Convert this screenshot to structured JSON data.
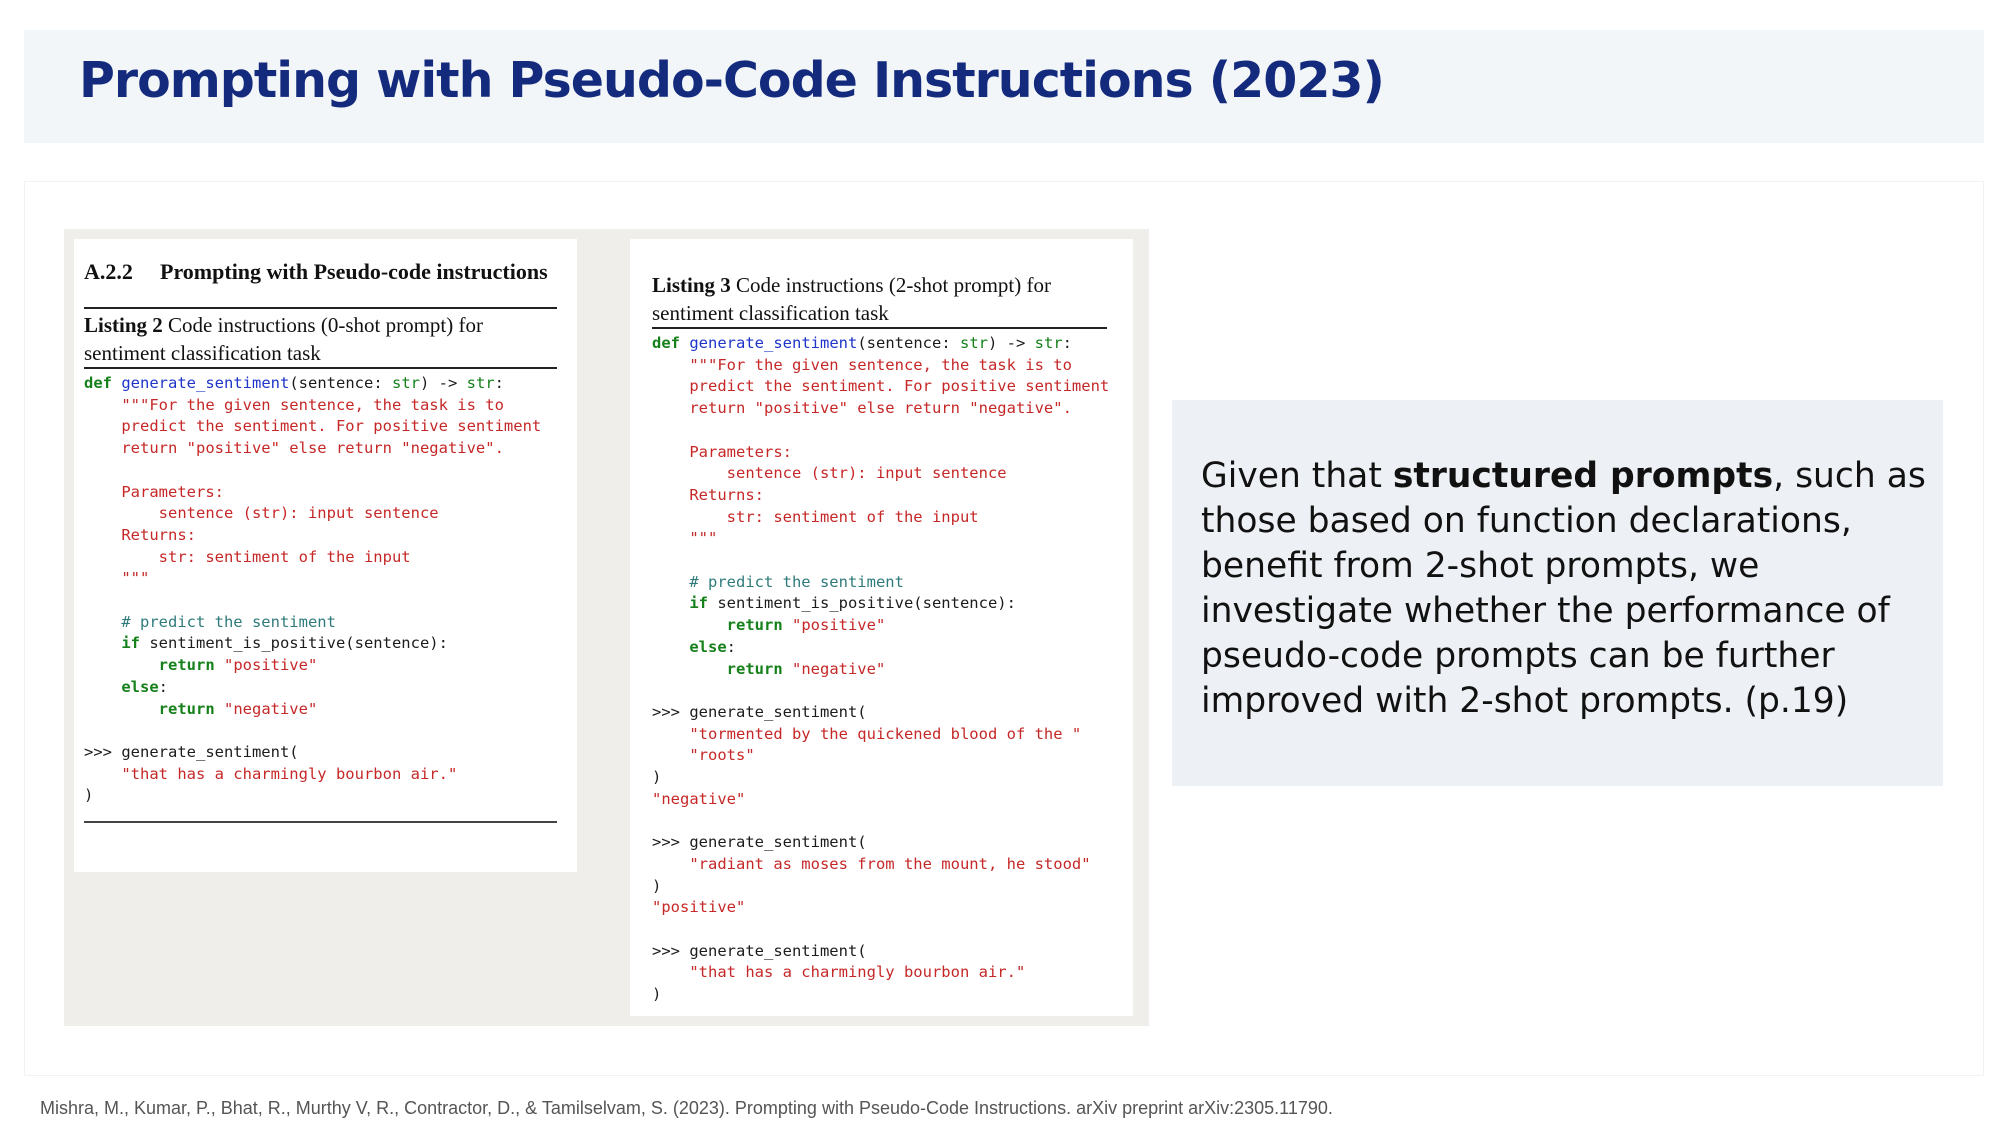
{
  "slide": {
    "title": "Prompting with Pseudo-Code Instructions (2023)",
    "citation": "Mishra, M., Kumar, P., Bhat, R., Murthy V, R., Contractor, D., & Tamilselvam, S. (2023). Prompting with Pseudo-Code Instructions. arXiv preprint arXiv:2305.11790."
  },
  "figure": {
    "left": {
      "section_number": "A.2.2",
      "section_title": "Prompting with Pseudo-code instructions",
      "listing_label": "Listing 2",
      "listing_caption_1": "Code instructions (0-shot prompt) for",
      "listing_caption_2": "sentiment classification task",
      "code": {
        "kw_def": "def",
        "fn_name": "generate_sentiment",
        "sig_open": "(sentence: ",
        "ty_str1": "str",
        "sig_arrow": ") -> ",
        "ty_str2": "str",
        "sig_colon": ":",
        "doc1": "\"\"\"For the given sentence, the task is to",
        "doc2": "predict the sentiment. For positive sentiment",
        "doc3": "return \"positive\" else return \"negative\".",
        "doc4": "Parameters:",
        "doc5": "sentence (str): input sentence",
        "doc6": "Returns:",
        "doc7": "str: sentiment of the input",
        "doc8": "\"\"\"",
        "comment": "# predict the sentiment",
        "kw_if": "if",
        "cond": " sentiment_is_positive(sentence):",
        "kw_return1": "return",
        "str_pos": " \"positive\"",
        "kw_else": "else",
        "else_colon": ":",
        "kw_return2": "return",
        "str_neg": " \"negative\"",
        "call": ">>> generate_sentiment(",
        "call_arg": "\"that has a charmingly bourbon air.\"",
        "call_close": ")"
      }
    },
    "right": {
      "listing_label": "Listing 3",
      "listing_caption_1": "Code instructions (2-shot prompt) for",
      "listing_caption_2": "sentiment classification task",
      "code": {
        "kw_def": "def",
        "fn_name": "generate_sentiment",
        "sig_open": "(sentence: ",
        "ty_str1": "str",
        "sig_arrow": ") -> ",
        "ty_str2": "str",
        "sig_colon": ":",
        "doc1": "\"\"\"For the given sentence, the task is to",
        "doc2": "predict the sentiment. For positive sentiment",
        "doc3": "return \"positive\" else return \"negative\".",
        "doc4": "Parameters:",
        "doc5": "sentence (str): input sentence",
        "doc6": "Returns:",
        "doc7": "str: sentiment of the input",
        "doc8": "\"\"\"",
        "comment": "# predict the sentiment",
        "kw_if": "if",
        "cond": " sentiment_is_positive(sentence):",
        "kw_return1": "return",
        "str_pos": " \"positive\"",
        "kw_else": "else",
        "else_colon": ":",
        "kw_return2": "return",
        "str_neg": " \"negative\"",
        "ex1_call": ">>> generate_sentiment(",
        "ex1_arg1": "\"tormented by the quickened blood of the \"",
        "ex1_arg2": "\"roots\"",
        "ex1_close": ")",
        "ex1_out": "\"negative\"",
        "ex2_call": ">>> generate_sentiment(",
        "ex2_arg": "\"radiant as moses from the mount, he stood\"",
        "ex2_close": ")",
        "ex2_out": "\"positive\"",
        "ex3_call": ">>> generate_sentiment(",
        "ex3_arg": "\"that has a charmingly bourbon air.\"",
        "ex3_close": ")"
      }
    }
  },
  "callout": {
    "text_pre": "Given that ",
    "text_bold": "structured prompts",
    "text_post": ", such as those based on function declarations, benefit from 2-shot prompts, we investigate whether the performance of pseudo-code prompts can be further improved with 2-shot prompts. (p.19)"
  }
}
